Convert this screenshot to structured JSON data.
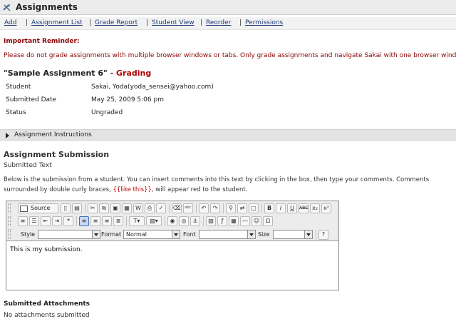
{
  "app": {
    "title": "Assignments",
    "icon": "tools-icon"
  },
  "nav": {
    "items": [
      {
        "label": "Add"
      },
      {
        "label": "Assignment List"
      },
      {
        "label": "Grade Report"
      },
      {
        "label": "Student View"
      },
      {
        "label": "Reorder"
      },
      {
        "label": "Permissions"
      }
    ],
    "separator": "|"
  },
  "reminder": {
    "title": "Important Reminder:",
    "text": "Please do not grade assignments with multiple browser windows or tabs. Only grade assignments and navigate Sakai with one browser window."
  },
  "assignment": {
    "name": "\"Sample Assignment 6\"",
    "dash": " - ",
    "mode": "Grading"
  },
  "info": {
    "rows": [
      {
        "label": "Student",
        "value": "Sakai, Yoda(yoda_sensei@yahoo.com)"
      },
      {
        "label": "Submitted Date",
        "value": "May 25, 2009 5:06 pm"
      },
      {
        "label": "Status",
        "value": "Ungraded"
      }
    ]
  },
  "instructions": {
    "label": "Assignment Instructions"
  },
  "submission": {
    "heading": "Assignment Submission",
    "subheading": "Submitted Text",
    "desc_part1": "Below is the submission from a student. You can insert comments into this text by clicking in the box, then type your comments. Comments surrounded by double curly braces, ",
    "desc_red": "{{like this}}",
    "desc_part2": ", will appear red to the student."
  },
  "editor": {
    "source_label": "Source",
    "style_label": "Style",
    "style_value": "",
    "format_label": "Format",
    "format_value": "Normal",
    "font_label": "Font",
    "font_value": "",
    "size_label": "Size",
    "size_value": "",
    "content": "This is my submission.",
    "bold_glyph": "B",
    "italic_glyph": "I",
    "underline_glyph": "U",
    "strike_glyph": "ABC",
    "subscript_glyph": "x₂",
    "superscript_glyph": "x²",
    "help_glyph": "?"
  },
  "attachments": {
    "heading": "Submitted Attachments",
    "text": "No attachments submitted"
  }
}
